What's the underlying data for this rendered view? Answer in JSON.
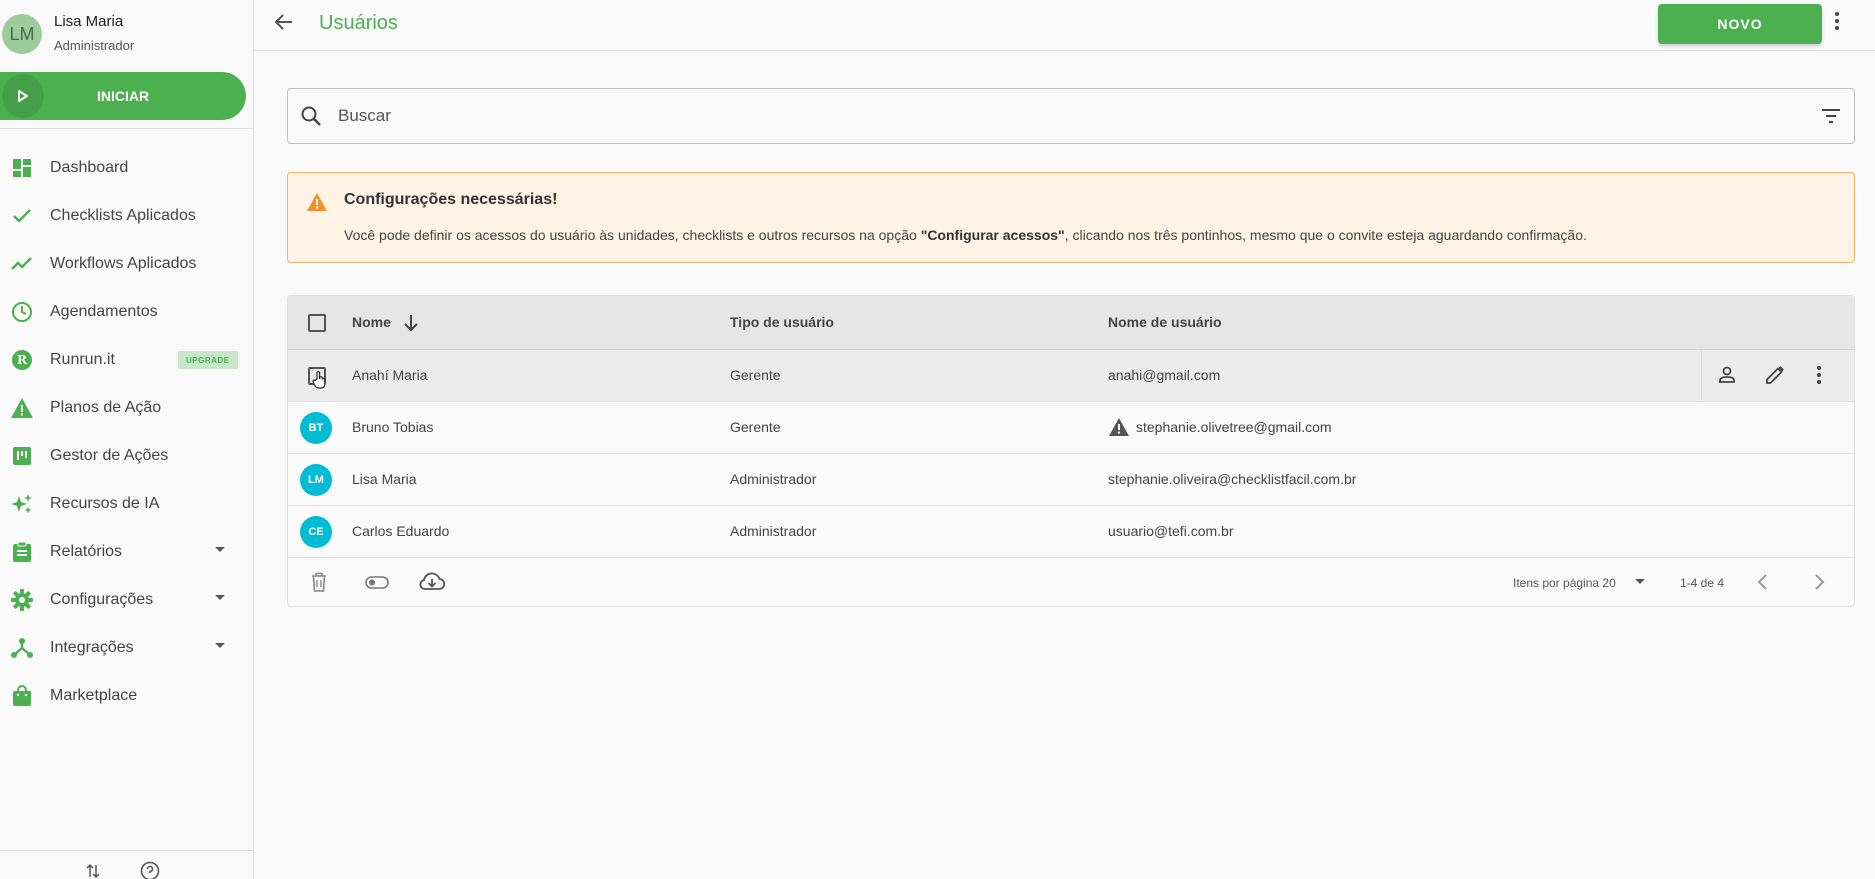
{
  "profile": {
    "initials": "LM",
    "name": "Lisa Maria",
    "role": "Administrador"
  },
  "start_button": {
    "label": "INICIAR"
  },
  "nav": {
    "items": [
      {
        "label": "Dashboard",
        "icon": "dashboard-icon"
      },
      {
        "label": "Checklists Aplicados",
        "icon": "check-icon"
      },
      {
        "label": "Workflows Aplicados",
        "icon": "trending-icon"
      },
      {
        "label": "Agendamentos",
        "icon": "clock-icon"
      },
      {
        "label": "Runrun.it",
        "icon": "runrun-icon",
        "badge": "UPGRADE"
      },
      {
        "label": "Planos de Ação",
        "icon": "warning-icon"
      },
      {
        "label": "Gestor de Ações",
        "icon": "board-icon"
      },
      {
        "label": "Recursos de IA",
        "icon": "sparkles-icon"
      },
      {
        "label": "Relatórios",
        "icon": "clipboard-icon"
      },
      {
        "label": "Configurações",
        "icon": "gear-icon"
      },
      {
        "label": "Integrações",
        "icon": "hub-icon"
      },
      {
        "label": "Marketplace",
        "icon": "bag-icon"
      }
    ]
  },
  "header": {
    "title": "Usuários",
    "new_label": "NOVO"
  },
  "search": {
    "placeholder": "Buscar"
  },
  "alert": {
    "title": "Configurações necessárias!",
    "text_before": "Você pode definir os acessos do usuário às unidades, checklists e outros recursos na opção ",
    "text_bold": "\"Configurar acessos\"",
    "text_after": ", clicando nos três pontinhos, mesmo que o convite esteja aguardando confirmação."
  },
  "table": {
    "columns": {
      "name": "Nome",
      "type": "Tipo de usuário",
      "username": "Nome de usuário"
    },
    "rows": [
      {
        "initials": "",
        "name": "Anahí Maria",
        "type": "Gerente",
        "username": "anahi@gmail.com"
      },
      {
        "initials": "BT",
        "name": "Bruno Tobias",
        "type": "Gerente",
        "username": "stephanie.olivetree@gmail.com"
      },
      {
        "initials": "LM",
        "name": "Lisa Maria",
        "type": "Administrador",
        "username": "stephanie.oliveira@checklistfacil.com.br"
      },
      {
        "initials": "CE",
        "name": "Carlos Eduardo",
        "type": "Administrador",
        "username": "usuario@tefi.com.br"
      }
    ],
    "footer": {
      "per_page": "Itens por página 20",
      "range": "1-4 de 4"
    }
  },
  "colors": {
    "accent": "#4caf50",
    "avatar": "#00bcd4",
    "alert_bg": "#fff3e6",
    "alert_border": "#f5b06a"
  }
}
